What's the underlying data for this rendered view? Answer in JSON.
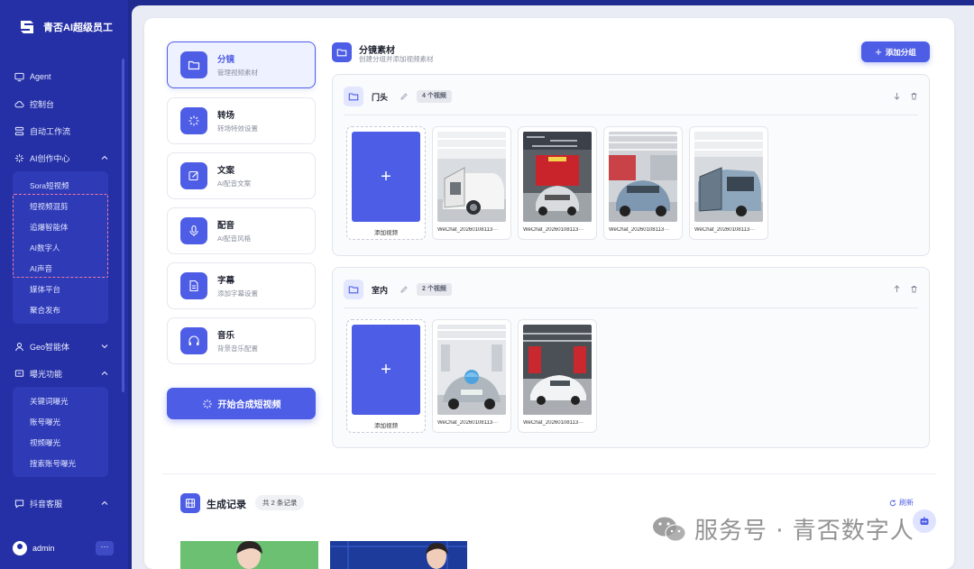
{
  "app": {
    "title": "青否AI超级员工"
  },
  "sidebar": {
    "items": [
      {
        "label": "Agent",
        "icon": "monitor-icon"
      },
      {
        "label": "控制台",
        "icon": "cloud-icon"
      },
      {
        "label": "自动工作流",
        "icon": "workflow-icon"
      },
      {
        "label": "AI创作中心",
        "icon": "sparkle-icon",
        "expanded": true
      }
    ],
    "ai_sub": [
      "Sora短视频",
      "短视频混剪",
      "追爆智能体",
      "AI数字人",
      "AI声音",
      "媒体平台",
      "聚合发布"
    ],
    "geo": {
      "label": "Geo智能体",
      "icon": "person-icon"
    },
    "exposure": {
      "label": "曝光功能",
      "icon": "megaphone-icon",
      "expanded": true
    },
    "exposure_sub": [
      "关键词曝光",
      "账号曝光",
      "视频曝光",
      "搜索账号曝光"
    ],
    "douyin": {
      "label": "抖音客服",
      "icon": "chat-icon"
    },
    "user": {
      "name": "admin",
      "more": "···"
    }
  },
  "steps": [
    {
      "title": "分镜",
      "sub": "管理视频素材",
      "icon": "folder-icon",
      "active": true
    },
    {
      "title": "转场",
      "sub": "转场特效设置",
      "icon": "transition-icon"
    },
    {
      "title": "文案",
      "sub": "AI配音文案",
      "icon": "edit-icon"
    },
    {
      "title": "配音",
      "sub": "AI配音风格",
      "icon": "mic-icon"
    },
    {
      "title": "字幕",
      "sub": "添加字幕设置",
      "icon": "document-icon"
    },
    {
      "title": "音乐",
      "sub": "背景音乐配置",
      "icon": "headphones-icon"
    }
  ],
  "compose_button": "开始合成短视频",
  "section": {
    "title": "分镜素材",
    "sub": "创建分组并添加视频素材",
    "add_group": "添加分组"
  },
  "groups": [
    {
      "name": "门头",
      "badge": "4 个视频",
      "add_label": "添加视频",
      "videos": [
        "WeChat_20260108113···",
        "WeChat_20260108113···",
        "WeChat_20260108113···",
        "WeChat_20260108113···"
      ]
    },
    {
      "name": "室内",
      "badge": "2 个视频",
      "add_label": "添加视频",
      "videos": [
        "WeChat_20260108113···",
        "WeChat_20260108113···"
      ]
    }
  ],
  "records": {
    "title": "生成记录",
    "count": "共 2 条记录",
    "refresh": "刷新"
  },
  "watermark": {
    "text": "服务号 · 青否数字人"
  },
  "colors": {
    "accent": "#4d5de6",
    "sidebar": "#2530a6",
    "highlight_dash": "#f07aa6"
  }
}
